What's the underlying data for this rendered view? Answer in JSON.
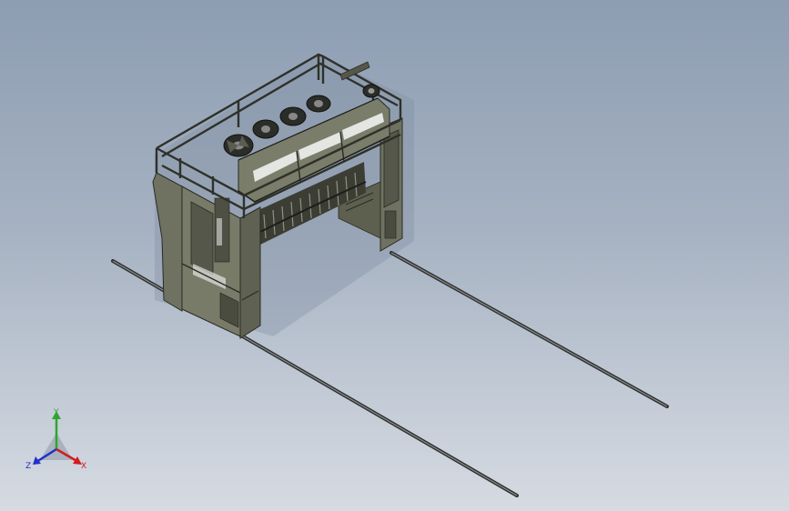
{
  "viewport": {
    "background_top": "#8d9db2",
    "background_bottom": "#d6dbe2"
  },
  "model": {
    "body_color": "#6f7260",
    "frame_color": "#3a3c33",
    "highlight_color": "#e4e6e2",
    "rail_color": "#2e3030"
  },
  "triad": {
    "x_label": "X",
    "y_label": "Y",
    "z_label": "Z",
    "x_color": "#d21c1c",
    "y_color": "#2fa52f",
    "z_color": "#2030c8"
  }
}
